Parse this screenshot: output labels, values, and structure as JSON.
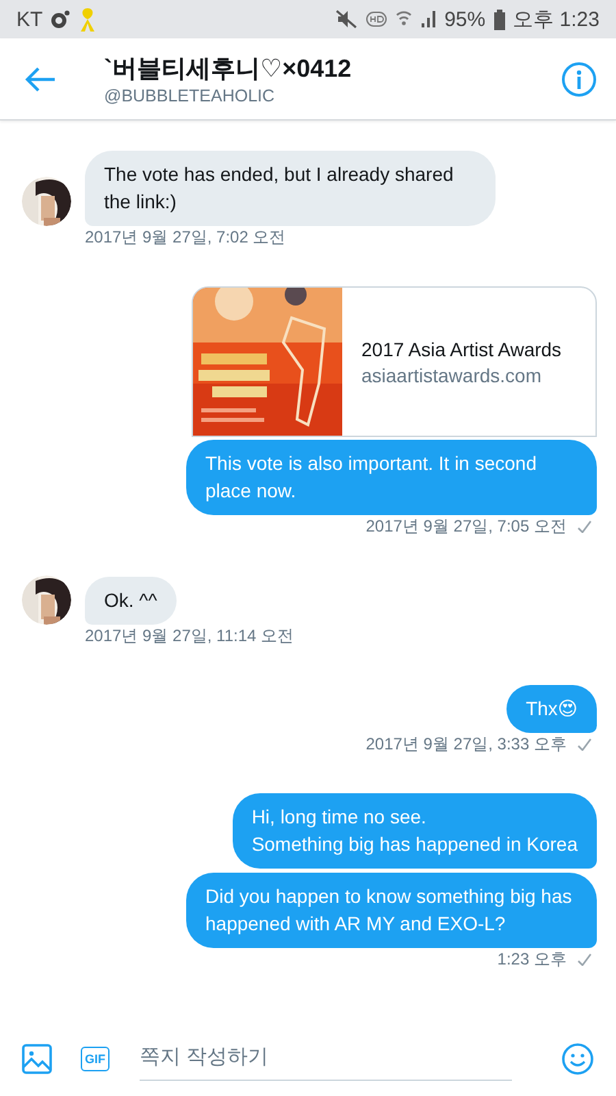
{
  "status_bar": {
    "carrier": "KT",
    "battery": "95%",
    "time": "오후 1:23"
  },
  "header": {
    "name": "`버블티세후니♡×0412",
    "handle": "@BUBBLETEAHOLIC"
  },
  "messages": [
    {
      "kind": "received",
      "text": "The vote has ended, but I already shared the link:)"
    },
    {
      "kind": "received_time",
      "text": "2017년 9월 27일, 7:02 오전"
    },
    {
      "kind": "link_card",
      "title": "2017 Asia Artist Awards",
      "domain": "asiaartistawards.com"
    },
    {
      "kind": "sent",
      "text": "This vote is also important. It in second place now."
    },
    {
      "kind": "sent_time",
      "text": "2017년 9월 27일, 7:05 오전",
      "read": true
    },
    {
      "kind": "received",
      "text": "Ok. ^^"
    },
    {
      "kind": "received_time",
      "text": "2017년 9월 27일, 11:14 오전"
    },
    {
      "kind": "sent",
      "text": "Thx😍"
    },
    {
      "kind": "sent_time",
      "text": "2017년 9월 27일, 3:33 오후",
      "read": true
    },
    {
      "kind": "sent",
      "text": "Hi, long time no see.\nSomething big has happened in Korea"
    },
    {
      "kind": "sent",
      "text": "Did you happen to know something big has happened with AR MY and EXO-L?"
    },
    {
      "kind": "sent_time",
      "text": "1:23 오후",
      "read": true
    }
  ],
  "composer": {
    "gif_label": "GIF",
    "placeholder": "쪽지 작성하기"
  }
}
